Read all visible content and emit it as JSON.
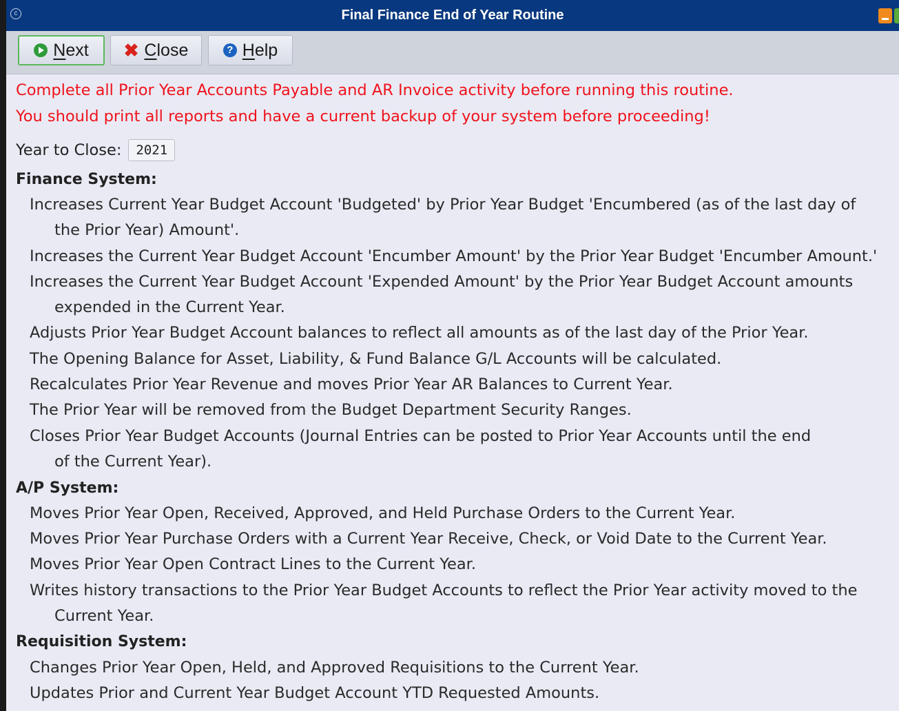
{
  "window": {
    "title": "Final Finance End of Year Routine",
    "app_icon": "app-logo-icon"
  },
  "toolbar": {
    "next": {
      "underline": "N",
      "rest": "ext",
      "icon": "arrow-right-circle-icon"
    },
    "close": {
      "underline": "C",
      "rest": "lose",
      "icon": "close-x-icon"
    },
    "help": {
      "underline": "H",
      "rest": "elp",
      "icon": "question-circle-icon"
    }
  },
  "warnings": [
    "Complete all Prior Year Accounts Payable and AR Invoice activity before running this routine.",
    "You should print all reports and have a current backup of your system before proceeding!"
  ],
  "year_to_close": {
    "label": "Year to Close:",
    "value": "2021"
  },
  "sections": {
    "finance": {
      "heading": "Finance System:",
      "lines": [
        "Increases Current Year Budget Account 'Budgeted' by Prior Year Budget 'Encumbered (as of the last day of",
        "the Prior Year) Amount'.",
        "Increases the Current Year Budget Account 'Encumber Amount' by the Prior Year Budget 'Encumber Amount.'",
        "Increases the Current Year Budget Account 'Expended Amount' by the Prior Year Budget Account amounts",
        "expended in the Current Year.",
        "Adjusts Prior Year Budget Account balances to reflect all amounts as of the last day of the Prior Year.",
        "The Opening Balance for Asset, Liability, & Fund Balance G/L Accounts will be calculated.",
        "Recalculates Prior Year Revenue and moves Prior Year AR Balances to Current Year.",
        "The Prior Year will be removed from the Budget Department Security Ranges.",
        "Closes Prior Year Budget Accounts (Journal Entries can be posted to Prior Year Accounts until the end",
        "of the Current Year)."
      ]
    },
    "ap": {
      "heading": "A/P System:",
      "lines": [
        "Moves Prior Year Open, Received, Approved, and Held Purchase Orders to the Current Year.",
        "Moves Prior Year Purchase Orders with a Current Year Receive, Check, or Void Date to the Current Year.",
        "Moves Prior Year Open Contract Lines to the Current Year.",
        "Writes history transactions to the Prior Year Budget Accounts to reflect the Prior Year activity moved to the",
        "Current Year."
      ]
    },
    "requisition": {
      "heading": "Requisition System:",
      "lines": [
        "Changes Prior Year Open, Held, and Approved Requisitions to the Current Year.",
        "Updates Prior and Current Year Budget Account YTD Requested Amounts."
      ]
    }
  },
  "colors": {
    "titlebar": "#08387f",
    "warning_text": "#f0131c",
    "background": "#e9eaf4"
  }
}
